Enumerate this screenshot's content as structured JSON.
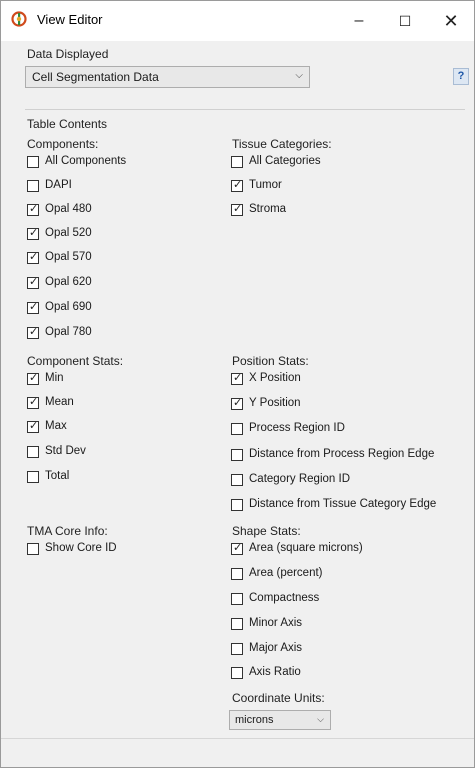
{
  "window": {
    "title": "View Editor",
    "minimize": "–",
    "maximize": "☐",
    "close": "✕"
  },
  "data_displayed": {
    "label": "Data Displayed",
    "value": "Cell Segmentation Data",
    "help": "?"
  },
  "table_contents": {
    "label": "Table Contents"
  },
  "components": {
    "label": "Components:",
    "items": [
      {
        "label": "All Components",
        "checked": false
      },
      {
        "label": "DAPI",
        "checked": false
      },
      {
        "label": "Opal 480",
        "checked": true
      },
      {
        "label": "Opal 520",
        "checked": true
      },
      {
        "label": "Opal 570",
        "checked": true
      },
      {
        "label": "Opal 620",
        "checked": true
      },
      {
        "label": "Opal 690",
        "checked": true
      },
      {
        "label": "Opal 780",
        "checked": true
      }
    ]
  },
  "tissue_categories": {
    "label": "Tissue Categories:",
    "items": [
      {
        "label": "All Categories",
        "checked": false
      },
      {
        "label": "Tumor",
        "checked": true
      },
      {
        "label": "Stroma",
        "checked": true
      }
    ]
  },
  "component_stats": {
    "label": "Component Stats:",
    "items": [
      {
        "label": "Min",
        "checked": true
      },
      {
        "label": "Mean",
        "checked": true
      },
      {
        "label": "Max",
        "checked": true
      },
      {
        "label": "Std Dev",
        "checked": false
      },
      {
        "label": "Total",
        "checked": false
      }
    ]
  },
  "position_stats": {
    "label": "Position Stats:",
    "items": [
      {
        "label": "X Position",
        "checked": true
      },
      {
        "label": "Y Position",
        "checked": true
      },
      {
        "label": "Process Region ID",
        "checked": false
      },
      {
        "label": "Distance from Process Region Edge",
        "checked": false
      },
      {
        "label": "Category Region ID",
        "checked": false
      },
      {
        "label": "Distance from Tissue Category Edge",
        "checked": false
      }
    ]
  },
  "tma_core_info": {
    "label": "TMA Core Info:",
    "items": [
      {
        "label": "Show Core ID",
        "checked": false
      }
    ]
  },
  "shape_stats": {
    "label": "Shape Stats:",
    "items": [
      {
        "label": "Area (square microns)",
        "checked": true
      },
      {
        "label": "Area (percent)",
        "checked": false
      },
      {
        "label": "Compactness",
        "checked": false
      },
      {
        "label": "Minor Axis",
        "checked": false
      },
      {
        "label": "Major Axis",
        "checked": false
      },
      {
        "label": "Axis Ratio",
        "checked": false
      }
    ]
  },
  "coordinate_units": {
    "label": "Coordinate Units:",
    "value": "microns"
  },
  "icons": {
    "check": "✓",
    "dropdown": "⌵"
  }
}
